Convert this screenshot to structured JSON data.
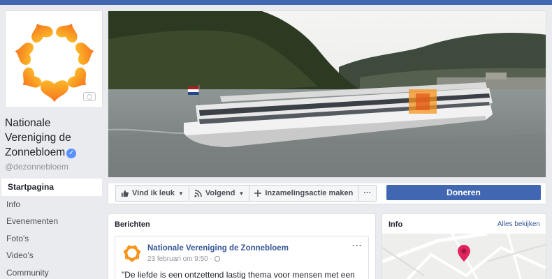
{
  "page": {
    "name": "Nationale Vereniging de Zonnebloem",
    "handle": "@dezonnebloem"
  },
  "nav": {
    "items": [
      {
        "label": "Startpagina"
      },
      {
        "label": "Info"
      },
      {
        "label": "Evenementen"
      },
      {
        "label": "Foto's"
      },
      {
        "label": "Video's"
      },
      {
        "label": "Community"
      }
    ]
  },
  "actions": {
    "like": "Vind ik leuk",
    "follow": "Volgend",
    "fundraiser": "Inzamelingsactie maken",
    "more": "···",
    "donate": "Doneren"
  },
  "posts": {
    "title": "Berichten",
    "first": {
      "author": "Nationale Vereniging de Zonnebloem",
      "time": "23 februari om 9:50 ·",
      "text": "\"De liefde is een ontzettend lastig thema voor mensen met een",
      "more": "···"
    }
  },
  "info": {
    "title": "Info",
    "link": "Alles bekijken"
  },
  "colors": {
    "brand_orange": "#f7941d",
    "facebook_blue": "#4267b2",
    "map_pin": "#e0245e"
  }
}
